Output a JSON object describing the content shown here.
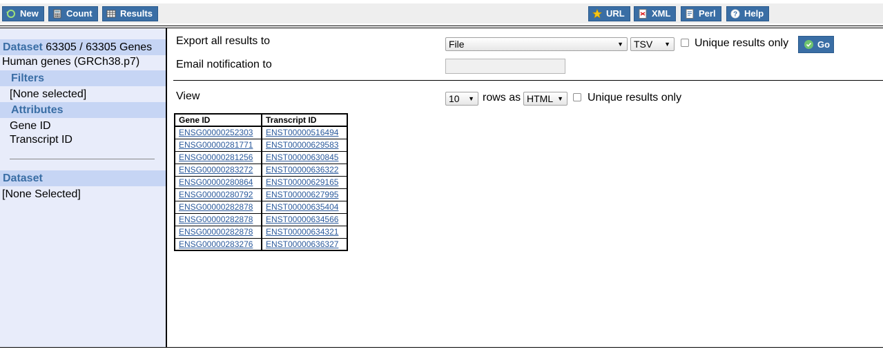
{
  "toolbar": {
    "new_label": "New",
    "count_label": "Count",
    "results_label": "Results",
    "url_label": "URL",
    "xml_label": "XML",
    "perl_label": "Perl",
    "help_label": "Help"
  },
  "sidebar": {
    "dataset_key": "Dataset",
    "dataset_count": "63305 / 63305 Genes",
    "dataset_name": "Human genes (GRCh38.p7)",
    "filters_label": "Filters",
    "filters_value": "[None selected]",
    "attributes_label": "Attributes",
    "attributes": [
      "Gene ID",
      "Transcript ID"
    ],
    "dataset2_label": "Dataset",
    "dataset2_value": "[None Selected]"
  },
  "export": {
    "label": "Export  all results to",
    "destination": "File",
    "format": "TSV",
    "unique_label": "Unique results only",
    "unique_checked": false,
    "go_label": "Go",
    "email_label": "Email notification to",
    "email_value": ""
  },
  "view": {
    "label": "View",
    "rows": "10",
    "rows_as_label": "rows as",
    "format": "HTML",
    "unique_label": "Unique results only",
    "unique_checked": false
  },
  "results": {
    "columns": [
      "Gene ID",
      "Transcript ID"
    ],
    "rows": [
      [
        "ENSG00000252303",
        "ENST00000516494"
      ],
      [
        "ENSG00000281771",
        "ENST00000629583"
      ],
      [
        "ENSG00000281256",
        "ENST00000630845"
      ],
      [
        "ENSG00000283272",
        "ENST00000636322"
      ],
      [
        "ENSG00000280864",
        "ENST00000629165"
      ],
      [
        "ENSG00000280792",
        "ENST00000627995"
      ],
      [
        "ENSG00000282878",
        "ENST00000635404"
      ],
      [
        "ENSG00000282878",
        "ENST00000634566"
      ],
      [
        "ENSG00000282878",
        "ENST00000634321"
      ],
      [
        "ENSG00000283276",
        "ENST00000636327"
      ]
    ]
  },
  "colors": {
    "button_blue": "#3a6ea5",
    "sidebar_bg": "#e8ecfa",
    "sidebar_header_bg": "#c6d5f4",
    "link_color": "#2b5a9c"
  }
}
